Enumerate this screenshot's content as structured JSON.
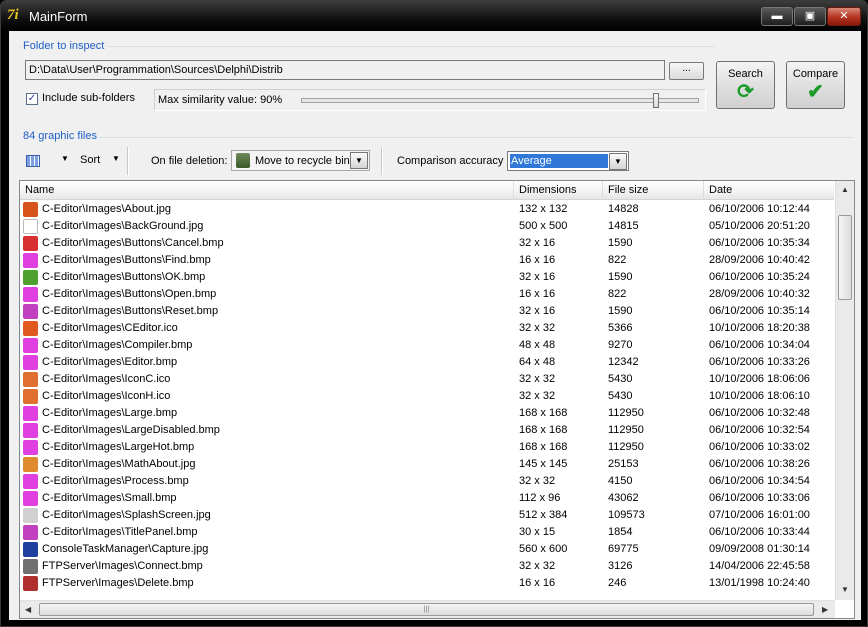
{
  "window": {
    "title": "MainForm",
    "app_icon_glyph": "7i",
    "min_glyph": "▬",
    "max_glyph": "▣",
    "close_glyph": "✕"
  },
  "folder_group": {
    "title": "Folder to inspect",
    "path": "D:\\Data\\User\\Programmation\\Sources\\Delphi\\Distrib",
    "browse_label": "...",
    "include_subfolders_label": "Include sub-folders",
    "include_subfolders_checked": true,
    "similarity_label": "Max similarity value: 90%",
    "similarity_value": 0.9
  },
  "buttons": {
    "search_label": "Search",
    "compare_label": "Compare",
    "search_icon": "refresh-icon",
    "compare_icon": "checkmark-icon"
  },
  "files_group": {
    "title": "84 graphic files",
    "sort_label": "Sort",
    "deletion_label": "On file deletion:",
    "deletion_value": "Move to recycle bin",
    "accuracy_label": "Comparison accuracy",
    "accuracy_value": "Average"
  },
  "columns": {
    "name": "Name",
    "dimensions": "Dimensions",
    "size": "File size",
    "date": "Date"
  },
  "files": [
    {
      "name": "C-Editor\\Images\\About.jpg",
      "dim": "132 x 132",
      "size": "14828",
      "date": "06/10/2006 10:12:44",
      "color": "#d8531c"
    },
    {
      "name": "C-Editor\\Images\\BackGround.jpg",
      "dim": "500 x 500",
      "size": "14815",
      "date": "05/10/2006 20:51:20",
      "color": "#ffffff"
    },
    {
      "name": "C-Editor\\Images\\Buttons\\Cancel.bmp",
      "dim": "32 x 16",
      "size": "1590",
      "date": "06/10/2006 10:35:34",
      "color": "#d83030"
    },
    {
      "name": "C-Editor\\Images\\Buttons\\Find.bmp",
      "dim": "16 x 16",
      "size": "822",
      "date": "28/09/2006 10:40:42",
      "color": "#e040e0"
    },
    {
      "name": "C-Editor\\Images\\Buttons\\OK.bmp",
      "dim": "32 x 16",
      "size": "1590",
      "date": "06/10/2006 10:35:24",
      "color": "#50a030"
    },
    {
      "name": "C-Editor\\Images\\Buttons\\Open.bmp",
      "dim": "16 x 16",
      "size": "822",
      "date": "28/09/2006 10:40:32",
      "color": "#e040e0"
    },
    {
      "name": "C-Editor\\Images\\Buttons\\Reset.bmp",
      "dim": "32 x 16",
      "size": "1590",
      "date": "06/10/2006 10:35:14",
      "color": "#c040c0"
    },
    {
      "name": "C-Editor\\Images\\CEditor.ico",
      "dim": "32 x 32",
      "size": "5366",
      "date": "10/10/2006 18:20:38",
      "color": "#e05a20"
    },
    {
      "name": "C-Editor\\Images\\Compiler.bmp",
      "dim": "48 x 48",
      "size": "9270",
      "date": "06/10/2006 10:34:04",
      "color": "#e040e0"
    },
    {
      "name": "C-Editor\\Images\\Editor.bmp",
      "dim": "64 x 48",
      "size": "12342",
      "date": "06/10/2006 10:33:26",
      "color": "#e040e0"
    },
    {
      "name": "C-Editor\\Images\\IconC.ico",
      "dim": "32 x 32",
      "size": "5430",
      "date": "10/10/2006 18:06:06",
      "color": "#e07030"
    },
    {
      "name": "C-Editor\\Images\\IconH.ico",
      "dim": "32 x 32",
      "size": "5430",
      "date": "10/10/2006 18:06:10",
      "color": "#e07030"
    },
    {
      "name": "C-Editor\\Images\\Large.bmp",
      "dim": "168 x 168",
      "size": "112950",
      "date": "06/10/2006 10:32:48",
      "color": "#e040e0"
    },
    {
      "name": "C-Editor\\Images\\LargeDisabled.bmp",
      "dim": "168 x 168",
      "size": "112950",
      "date": "06/10/2006 10:32:54",
      "color": "#e040e0"
    },
    {
      "name": "C-Editor\\Images\\LargeHot.bmp",
      "dim": "168 x 168",
      "size": "112950",
      "date": "06/10/2006 10:33:02",
      "color": "#e040e0"
    },
    {
      "name": "C-Editor\\Images\\MathAbout.jpg",
      "dim": "145 x 145",
      "size": "25153",
      "date": "06/10/2006 10:38:26",
      "color": "#e08a30"
    },
    {
      "name": "C-Editor\\Images\\Process.bmp",
      "dim": "32 x 32",
      "size": "4150",
      "date": "06/10/2006 10:34:54",
      "color": "#e040e0"
    },
    {
      "name": "C-Editor\\Images\\Small.bmp",
      "dim": "112 x 96",
      "size": "43062",
      "date": "06/10/2006 10:33:06",
      "color": "#e040e0"
    },
    {
      "name": "C-Editor\\Images\\SplashScreen.jpg",
      "dim": "512 x 384",
      "size": "109573",
      "date": "07/10/2006 16:01:00",
      "color": "#d0d0d0"
    },
    {
      "name": "C-Editor\\Images\\TitlePanel.bmp",
      "dim": "30 x 15",
      "size": "1854",
      "date": "06/10/2006 10:33:44",
      "color": "#c040c0"
    },
    {
      "name": "ConsoleTaskManager\\Capture.jpg",
      "dim": "560 x 600",
      "size": "69775",
      "date": "09/09/2008 01:30:14",
      "color": "#2040a0"
    },
    {
      "name": "FTPServer\\Images\\Connect.bmp",
      "dim": "32 x 32",
      "size": "3126",
      "date": "14/04/2006 22:45:58",
      "color": "#707070"
    },
    {
      "name": "FTPServer\\Images\\Delete.bmp",
      "dim": "16 x 16",
      "size": "246",
      "date": "13/01/1998 10:24:40",
      "color": "#b03030"
    }
  ]
}
